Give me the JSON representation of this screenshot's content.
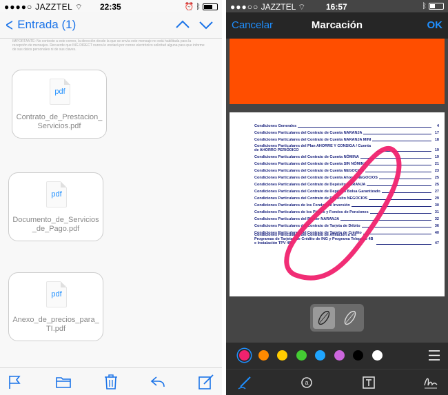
{
  "left": {
    "status": {
      "carrier": "JAZZTEL",
      "time": "22:35"
    },
    "nav": {
      "back_label": "Entrada (1)"
    },
    "legal_text": "IMPORTANTE: No conteste a este correo, la dirección desde la que se envía este mensaje no está habilitada para la recepción de mensajes. Recuerde que ING DIRECT nunca le enviará por correo electrónico solicitud alguna para que informe de sus datos personales ni de sus claves.",
    "attachments": [
      {
        "icon_label": "pdf",
        "filename": "Contrato_de_Prestacion_Servicios.pdf"
      },
      {
        "icon_label": "pdf",
        "filename": "Documento_de_Servicios_de_Pago.pdf"
      },
      {
        "icon_label": "pdf",
        "filename": "Anexo_de_precios_para_TI.pdf"
      }
    ]
  },
  "right": {
    "status": {
      "carrier": "JAZZTEL",
      "time": "16:57"
    },
    "nav": {
      "cancel_label": "Cancelar",
      "title": "Marcación",
      "ok_label": "OK"
    },
    "colors": {
      "banner": "#ff4e00",
      "accent": "#1f8fff",
      "markup_stroke": "#f0226e",
      "toc_text": "#1a237e"
    },
    "toc": [
      {
        "title": "Condiciones Generales",
        "page": "4"
      },
      {
        "title": "Condiciones Particulares del Contrato de Cuenta NARANJA",
        "page": "17"
      },
      {
        "title": "Condiciones Particulares del Contrato de Cuenta NARANJA MINI",
        "page": "18"
      },
      {
        "title": "Condiciones Particulares del Plan AHORRE Y CONSIGA / Cuenta de AHORRO PERIÓDICO",
        "page": "19",
        "two_line": true
      },
      {
        "title": "Condiciones Particulares del Contrato de Cuenta NÓMINA",
        "page": "19"
      },
      {
        "title": "Condiciones Particulares del Contrato de Cuenta SIN NÓMINA",
        "page": "21"
      },
      {
        "title": "Condiciones Particulares del Contrato de Cuenta NEGOCIOS",
        "page": "23"
      },
      {
        "title": "Condiciones Particulares del Contrato de Cuenta Ahorro NEGOCIOS",
        "page": "25"
      },
      {
        "title": "Condiciones Particulares del Contrato de Depósito NARANJA",
        "page": "25"
      },
      {
        "title": "Condiciones Particulares del Contrato de Depósito Bolsa Garantizado",
        "page": "27"
      },
      {
        "title": "Condiciones Particulares del Contrato de Depósito NEGOCIOS",
        "page": "29"
      },
      {
        "title": "Condiciones Particulares de los Fondos de Inversión",
        "page": "30"
      },
      {
        "title": "Condiciones Particulares de los Planes y Fondos de Pensiones",
        "page": "31"
      },
      {
        "title": "Condiciones Particulares del Broker NARANJA",
        "page": "32"
      },
      {
        "title": "Condiciones Particulares del Contrato de Tarjeta de Débito",
        "page": "36"
      },
      {
        "title": "Condiciones Particulares del Contrato de Tarjeta de Crédito",
        "page": "40"
      },
      {
        "title": "Condiciones Particulares del Contrato de Afiliación a los Programas de Tarjetas de Crédito de ING y Programa Telepago 4B e Instalación TPV 4B",
        "page": "47",
        "two_line": true
      }
    ],
    "palette": [
      "#f0226e",
      "#ff8a00",
      "#ffcc00",
      "#44cc33",
      "#1fa5ff",
      "#cc66dd",
      "#000000",
      "#ffffff"
    ],
    "selected_color_index": 0
  }
}
